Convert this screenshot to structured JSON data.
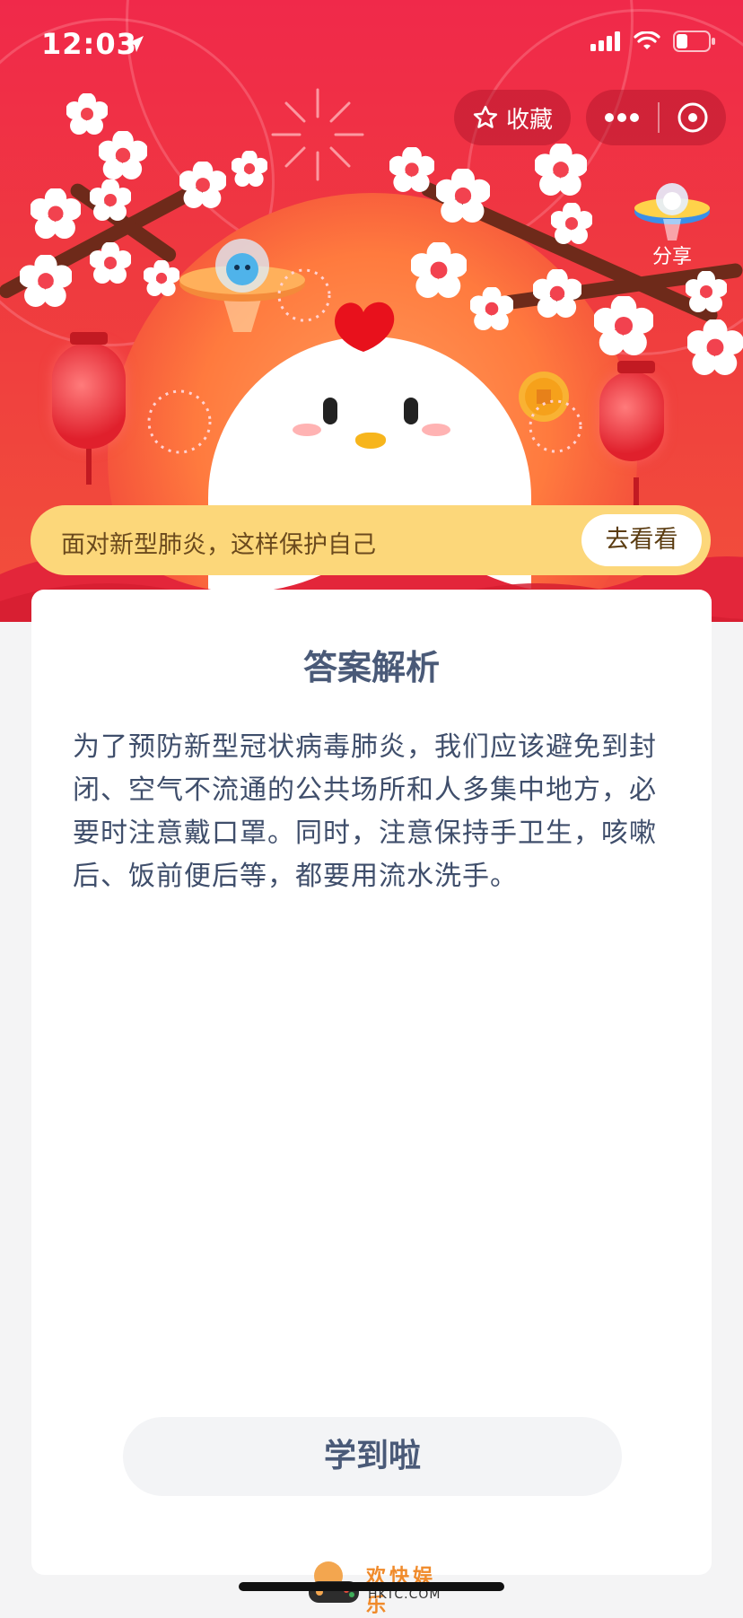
{
  "status_bar": {
    "time": "12:03",
    "icons": [
      "location-arrow-icon",
      "cellular-signal-icon",
      "wifi-icon",
      "battery-icon"
    ]
  },
  "header": {
    "favorite_label": "收藏",
    "favorite_icon": "star-outline-icon",
    "capsule_icons": [
      "more-icon",
      "close-circle-icon"
    ],
    "share_label": "分享",
    "share_icon": "ufo-share-icon",
    "illustration": {
      "accent_red": "#ef2f45",
      "sun_orange": "#ff8a4a",
      "blossom_color": "#ffffff",
      "branch_color": "#6e2a1a"
    }
  },
  "banner": {
    "text": "面对新型肺炎，这样保护自己",
    "button_label": "去看看",
    "background": "#fcd77a"
  },
  "answer_card": {
    "title": "答案解析",
    "body": "为了预防新型冠状病毒肺炎，我们应该避免到封闭、空气不流通的公共场所和人多集中地方，必要时注意戴口罩。同时，注意保持手卫生，咳嗽后、饭前便后等，都要用流水洗手。",
    "button_label": "学到啦"
  },
  "watermark": {
    "text": "欢快娱乐",
    "sub": "HKTC.COM"
  }
}
